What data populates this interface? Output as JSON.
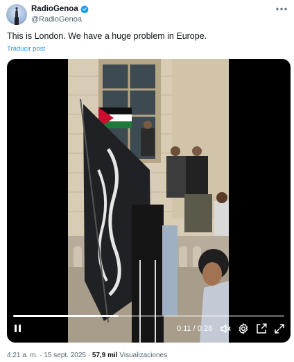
{
  "author": {
    "display_name": "RadioGenoa",
    "handle": "@RadioGenoa",
    "verified_color": "#1d9bf0"
  },
  "more_icon": "more-horizontal-icon",
  "tweet": {
    "text": "This is London. We have a huge problem in Europe.",
    "translate_label": "Traducir post"
  },
  "video": {
    "time_current": "0:11",
    "time_separator": "/",
    "time_total": "0:28",
    "progress": 0.39,
    "icons": [
      "pause-icon",
      "volume-muted-icon",
      "settings-gear-icon",
      "picture-in-picture-icon",
      "fullscreen-icon"
    ]
  },
  "meta": {
    "time": "4:21 a. m.",
    "dot1": "·",
    "date": "15 sept. 2025",
    "dot2": "·",
    "views": "57,9 mil",
    "views_label": "Visualizaciones"
  }
}
